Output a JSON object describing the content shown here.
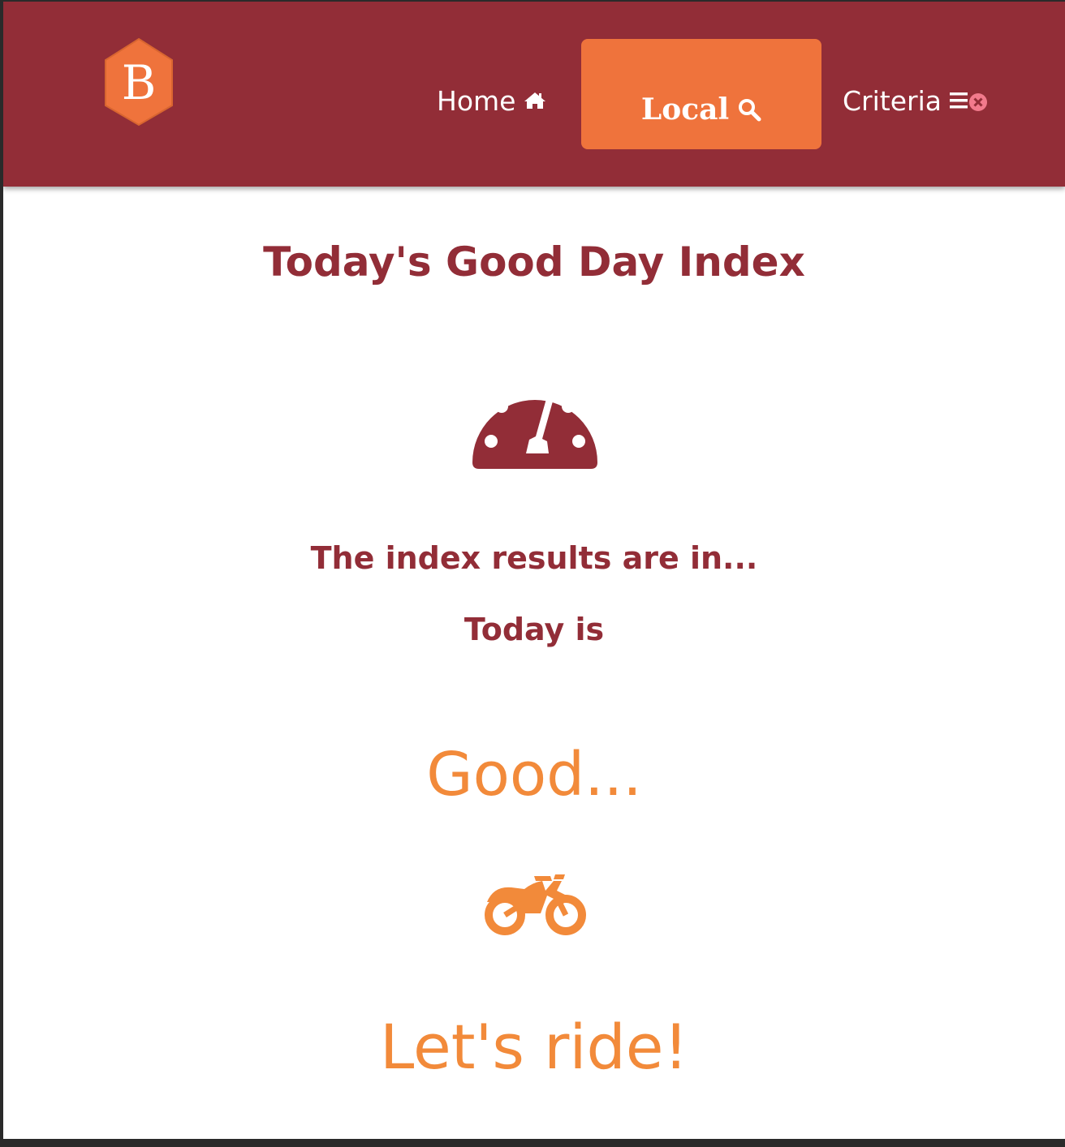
{
  "brand": {
    "logo_letter": "B",
    "logo_icon": "hexagon-b-logo",
    "logo_color": "#ef733c"
  },
  "nav": {
    "items": [
      {
        "label": "Home",
        "icon": "home-icon",
        "active": false
      },
      {
        "label": "Local",
        "icon": "search-icon",
        "active": true
      },
      {
        "label": "Criteria",
        "icon": "list-remove-icon",
        "active": false
      }
    ]
  },
  "main": {
    "title": "Today's Good Day Index",
    "gauge_icon": "dashboard-gauge-icon",
    "results_text": "The index results are in...",
    "today_text": "Today is",
    "verdict": "Good...",
    "verdict_icon": "motorcycle-icon",
    "cta": "Let's ride!"
  },
  "colors": {
    "navbar_bg": "#922d37",
    "accent": "#ef733c",
    "verdict": "#f28a3a",
    "heading": "#922d37",
    "criteria_x": "#f27a8c"
  }
}
